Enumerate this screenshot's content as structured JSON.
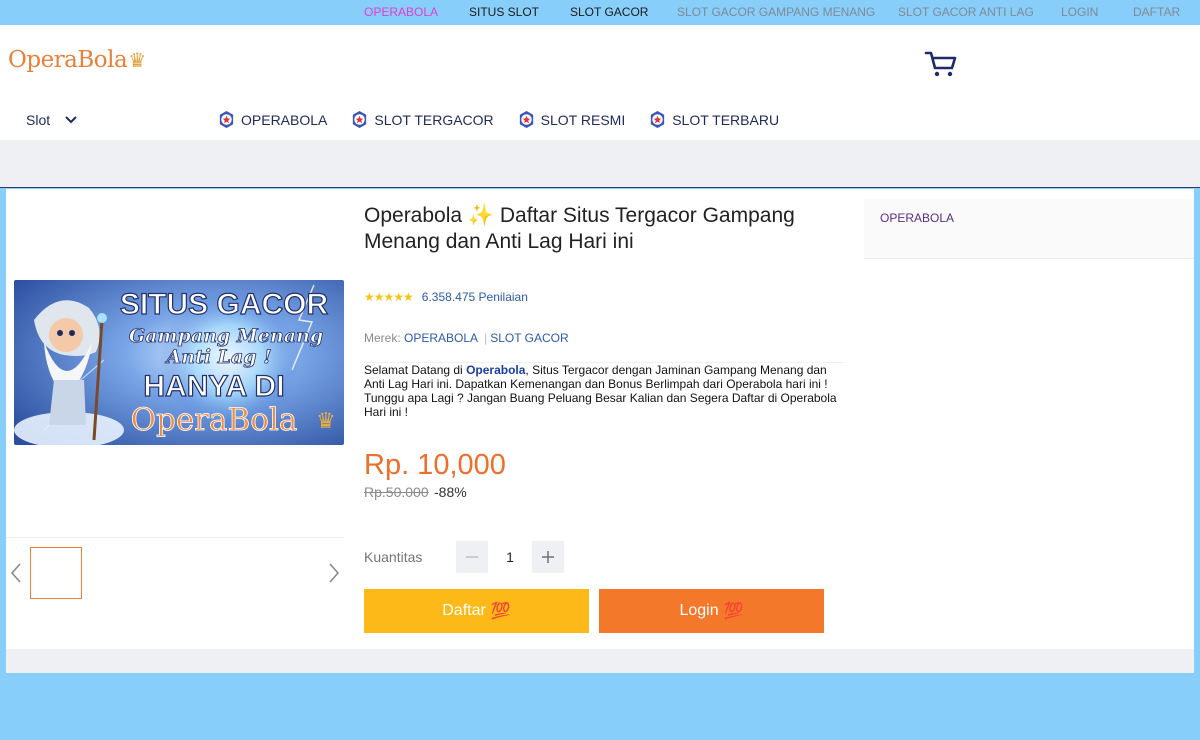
{
  "topnav": {
    "items": [
      {
        "label": "OPERABOLA",
        "color": "#e23dd6"
      },
      {
        "label": "SITUS SLOT",
        "color": "#1b1b1b"
      },
      {
        "label": "SLOT GACOR",
        "color": "#1b1b1b"
      },
      {
        "label": "SLOT GACOR GAMPANG MENANG",
        "color": "#7f8a96"
      },
      {
        "label": "SLOT GACOR ANTI LAG",
        "color": "#7f8a96"
      },
      {
        "label": "LOGIN",
        "color": "#7f8a96"
      },
      {
        "label": "DAFTAR",
        "color": "#7f8a96"
      }
    ]
  },
  "header": {
    "logo_text": "OperaBola",
    "logo_crown": "♛",
    "cart_icon": "cart-icon",
    "slot_menu_label": "Slot",
    "nav": [
      {
        "label": "OPERABOLA"
      },
      {
        "label": "SLOT TERGACOR"
      },
      {
        "label": "SLOT RESMI"
      },
      {
        "label": "SLOT TERBARU"
      }
    ]
  },
  "banner": {
    "line1": "SITUS GACOR",
    "line2": "Gampang Menang",
    "line3": "Anti Lag !",
    "line4": "HANYA DI",
    "line5": "OperaBola"
  },
  "product": {
    "title": "Operabola ✨ Daftar Situs Tergacor Gampang Menang dan Anti Lag Hari ini",
    "stars": "★★★★★",
    "rating_count": "6.358.475 Penilaian",
    "brand_label": "Merek:",
    "brand_1": "OPERABOLA",
    "brand_2": "SLOT GACOR",
    "desc_prefix": "Selamat Datang di ",
    "desc_highlight": "Operabola",
    "desc_rest": ", Situs Tergacor dengan Jaminan Gampang Menang dan Anti Lag Hari ini. Dapatkan Kemenangan dan Bonus Berlimpah dari Operabola hari ini ! Tunggu apa Lagi ? Jangan Buang Peluang Besar Kalian dan Segera Daftar di Operabola Hari ini !",
    "price": "Rp. 10,000",
    "old_price": "Rp.50.000",
    "discount": "-88%",
    "qty_label": "Kuantitas",
    "qty_value": "1",
    "daftar_label": "Daftar",
    "login_label": "Login",
    "emoji_100": "💯"
  },
  "sidebar": {
    "link": "OPERABOLA"
  },
  "colors": {
    "page_bg": "#87cefa",
    "accent_orange": "#f4782a",
    "accent_yellow": "#fdb918",
    "price": "#ee6e2a",
    "nav_text": "#1e2a5a"
  }
}
